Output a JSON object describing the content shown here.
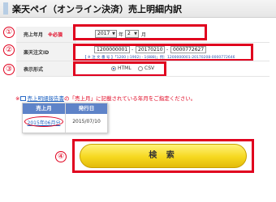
{
  "header": {
    "title": "楽天ペイ（オンライン決済）売上明細内訳"
  },
  "markers": [
    "①",
    "②",
    "③",
    "④"
  ],
  "form": {
    "sales_month": {
      "label": "売上年月",
      "required": "※必須",
      "year_value": "2017",
      "year_unit": "年",
      "month_value": "2",
      "month_unit": "月"
    },
    "order_id": {
      "label": "楽天注文ID",
      "part1": "1200000001",
      "part2": "20170210",
      "part3": "0000772627",
      "separator": "-",
      "example": "【 ※ 注 文 番 号 】「1200 (-1902) - 1(888)」例：1200000001-20170208-0000772646"
    },
    "display_format": {
      "label": "表示形式",
      "options": [
        "HTML",
        "CSV"
      ],
      "selected": "HTML"
    }
  },
  "note": {
    "prefix": "※",
    "link": "売上明細報告書",
    "text": "の「売上月」に記載されている年月をご指定ください。"
  },
  "example_table": {
    "headers": [
      "売上月",
      "発行日"
    ],
    "row": [
      "2015年06月分",
      "2015/07/10"
    ]
  },
  "search_button": {
    "label": "検 索"
  },
  "colors": {
    "highlight": "#e0001e",
    "table_header": "#5e83c8",
    "button": "#f6d81f"
  }
}
